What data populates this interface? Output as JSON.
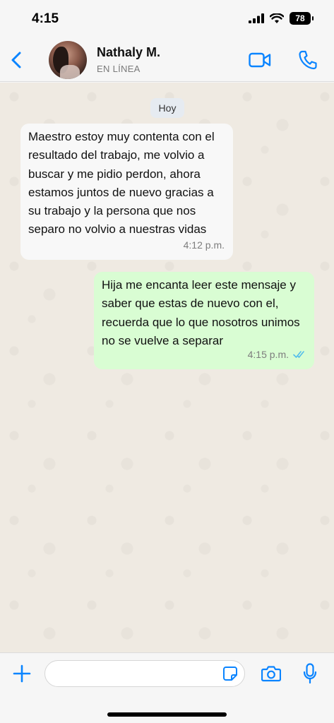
{
  "status_bar": {
    "time": "4:15",
    "battery": "78",
    "icons": [
      "signal-icon",
      "wifi-icon",
      "battery-icon"
    ]
  },
  "header": {
    "contact_name": "Nathaly M.",
    "contact_status": "EN LÍNEA",
    "icons": [
      "back-chevron-icon",
      "video-call-icon",
      "phone-icon"
    ]
  },
  "chat": {
    "date_chip": "Hoy",
    "messages": [
      {
        "direction": "incoming",
        "text": "Maestro estoy muy contenta con el resultado del trabajo, me volvio a buscar y me pidio perdon, ahora estamos juntos de nuevo gracias a su trabajo y la persona que nos separo no volvio a nuestras vidas",
        "time": "4:12 p.m."
      },
      {
        "direction": "outgoing",
        "text": "Hija me encanta leer este mensaje y saber que estas de nuevo con el, recuerda que lo que nosotros unimos no se vuelve a separar",
        "time": "4:15 p.m.",
        "status": "read"
      }
    ]
  },
  "composer": {
    "input_value": "",
    "icons": [
      "plus-icon",
      "sticker-icon",
      "camera-icon",
      "microphone-icon"
    ]
  },
  "colors": {
    "accent": "#0a84ff",
    "incoming_bubble": "#f8f8f8",
    "outgoing_bubble": "#d9fdd3",
    "chat_background": "#efeae2",
    "read_ticks": "#53bdeb"
  }
}
